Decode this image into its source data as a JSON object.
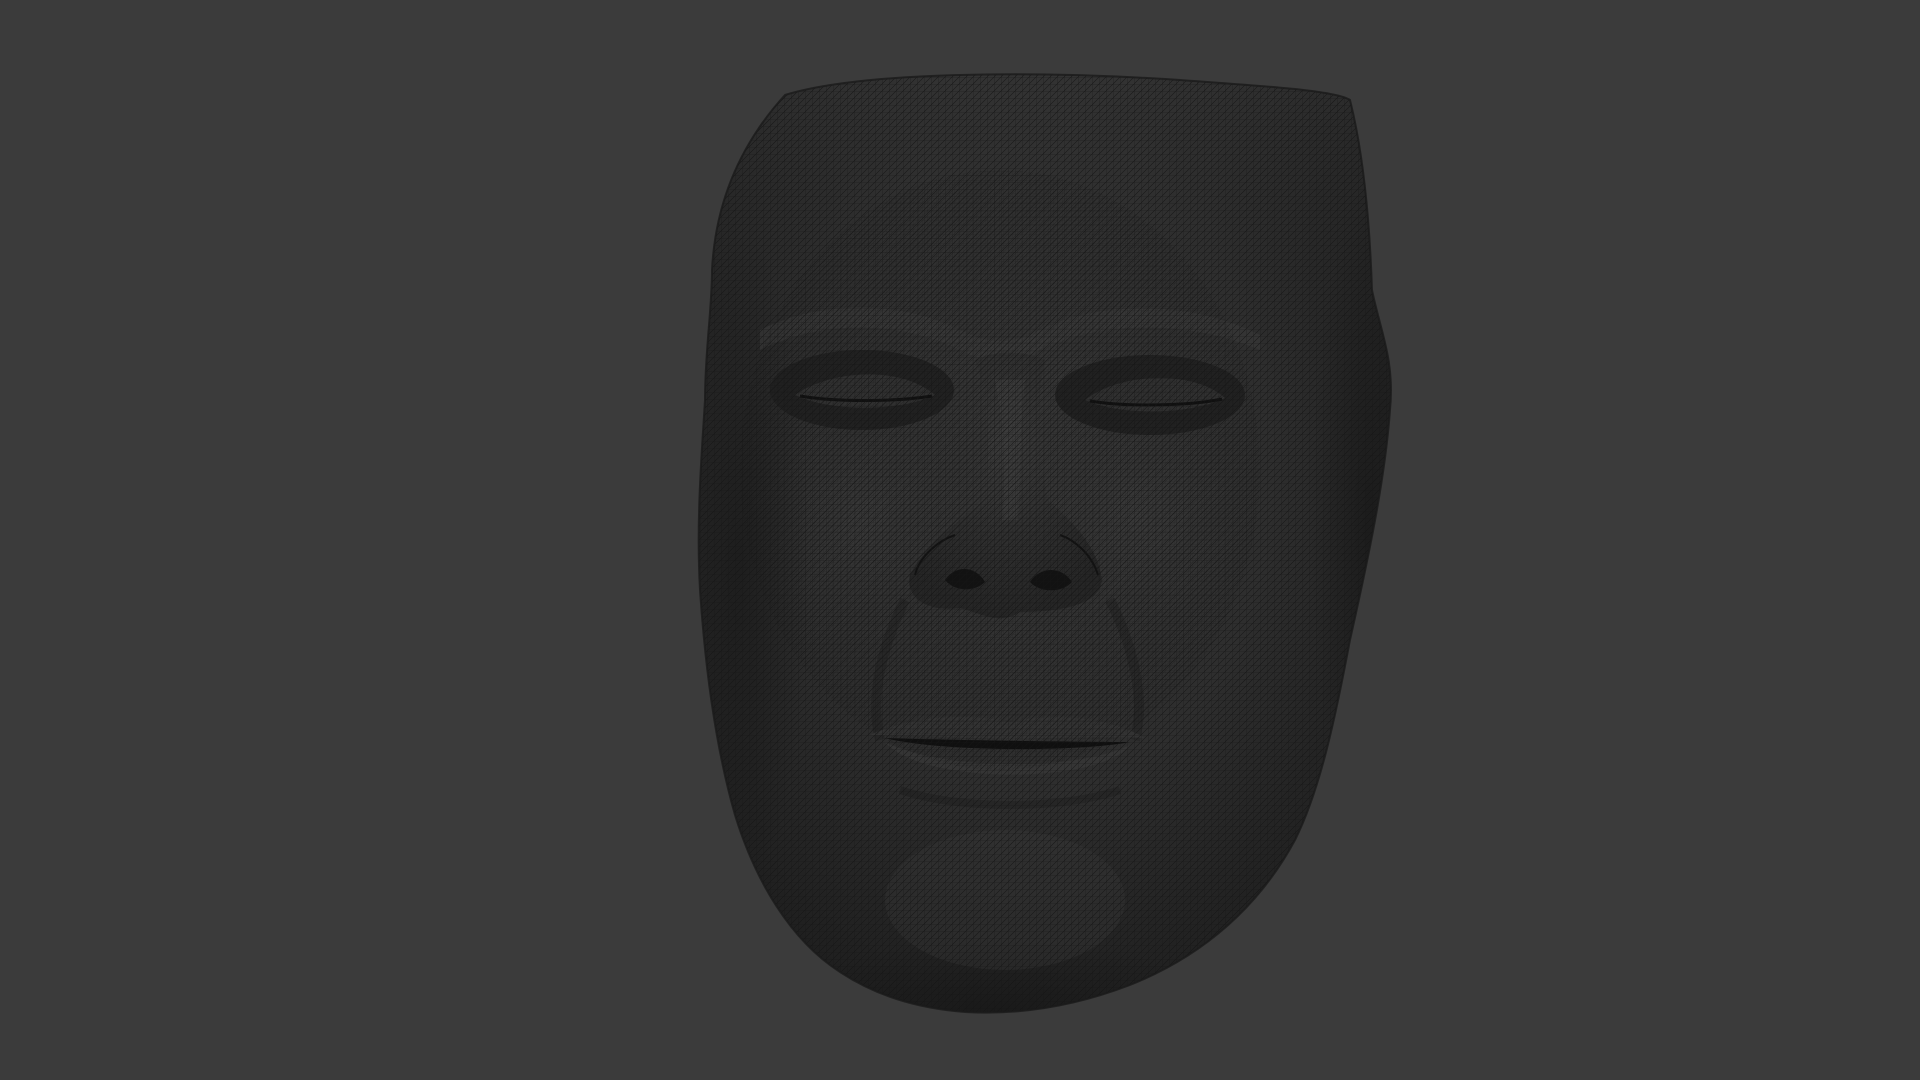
{
  "viewport": {
    "background_color": "#3b3b3b",
    "mesh_base_color": "#2c2c2c",
    "mesh_wire_color": "#151515",
    "mesh_highlight_color": "#4a4a4a",
    "subject": "face-mesh-icon"
  }
}
